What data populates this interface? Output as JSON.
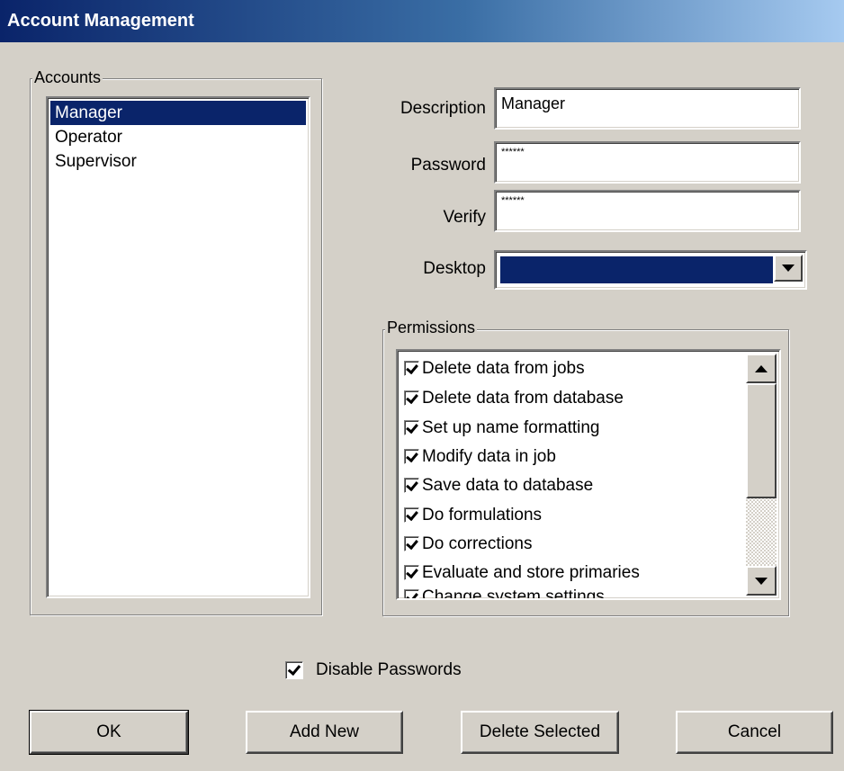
{
  "window": {
    "title": "Account Management"
  },
  "accounts": {
    "legend": "Accounts",
    "items": [
      {
        "label": "Manager",
        "selected": true
      },
      {
        "label": "Operator",
        "selected": false
      },
      {
        "label": "Supervisor",
        "selected": false
      }
    ]
  },
  "form": {
    "description_label": "Description",
    "description_value": "Manager",
    "password_label": "Password",
    "password_value": "******",
    "verify_label": "Verify",
    "verify_value": "******",
    "desktop_label": "Desktop",
    "desktop_value": ""
  },
  "permissions": {
    "legend": "Permissions",
    "items": [
      {
        "label": "Delete data from jobs",
        "checked": true
      },
      {
        "label": "Delete data from database",
        "checked": true
      },
      {
        "label": "Set up name formatting",
        "checked": true
      },
      {
        "label": "Modify data in job",
        "checked": true
      },
      {
        "label": "Save data to database",
        "checked": true
      },
      {
        "label": "Do formulations",
        "checked": true
      },
      {
        "label": "Do corrections",
        "checked": true
      },
      {
        "label": "Evaluate and store primaries",
        "checked": true
      },
      {
        "label": "Change system settings",
        "checked": true
      }
    ]
  },
  "disable_passwords": {
    "label": "Disable Passwords",
    "checked": true
  },
  "buttons": {
    "ok": "OK",
    "add_new": "Add New",
    "delete_selected": "Delete Selected",
    "cancel": "Cancel"
  },
  "colors": {
    "selection": "#0a246a",
    "face": "#d4d0c8"
  }
}
